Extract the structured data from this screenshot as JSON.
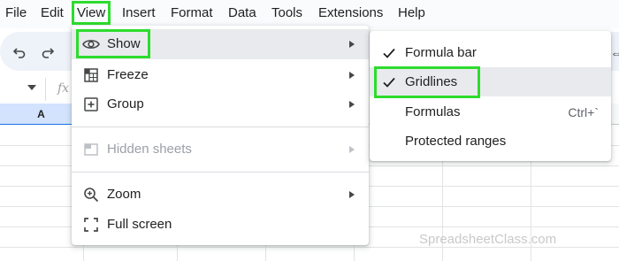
{
  "menubar": {
    "items": [
      "File",
      "Edit",
      "View",
      "Insert",
      "Format",
      "Data",
      "Tools",
      "Extensions",
      "Help"
    ],
    "active": "View"
  },
  "toolbar": {
    "icons": [
      "undo-icon",
      "redo-icon"
    ]
  },
  "formula_bar": {
    "fx_label": "fx"
  },
  "grid": {
    "columns": [
      "A"
    ]
  },
  "view_menu": {
    "items": [
      {
        "label": "Show",
        "icon": "eye-icon",
        "submenu": true,
        "highlighted": true
      },
      {
        "label": "Freeze",
        "icon": "freeze-icon",
        "submenu": true
      },
      {
        "label": "Group",
        "icon": "group-icon",
        "submenu": true
      },
      {
        "label": "Hidden sheets",
        "icon": "hidden-sheets-icon",
        "submenu": true,
        "disabled": true
      },
      {
        "label": "Zoom",
        "icon": "zoom-icon",
        "submenu": true
      },
      {
        "label": "Full screen",
        "icon": "fullscreen-icon",
        "submenu": false
      }
    ]
  },
  "show_submenu": {
    "items": [
      {
        "label": "Formula bar",
        "checked": true,
        "shortcut": ""
      },
      {
        "label": "Gridlines",
        "checked": true,
        "shortcut": "",
        "highlighted": true
      },
      {
        "label": "Formulas",
        "checked": false,
        "shortcut": "Ctrl+`"
      },
      {
        "label": "Protected ranges",
        "checked": false,
        "shortcut": ""
      }
    ]
  },
  "watermark": "SpreadsheetClass.com",
  "colors": {
    "highlight_box": "#2ddc2d",
    "menu_hover": "#e8eaed",
    "selected_column": "#d3e3fd"
  }
}
